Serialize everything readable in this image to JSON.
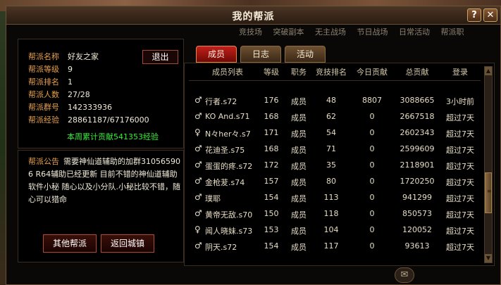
{
  "window": {
    "title": "我的帮派",
    "help_label": "?",
    "close_label": "✕"
  },
  "subnav": [
    "竞技场",
    "突破副本",
    "无主战场",
    "节日战场",
    "日常活动",
    "帮派职"
  ],
  "guild": {
    "name_label": "帮派名称",
    "name": "好友之家",
    "level_label": "帮派等级",
    "level": "9",
    "rank_label": "帮派排名",
    "rank": "1",
    "members_label": "帮派人数",
    "members": "27/28",
    "group_label": "帮派群号",
    "group": "142333936",
    "exp_label": "帮派经验",
    "exp": "28861187/67176000",
    "weekly_contrib": "本周累计贡献541353经验",
    "exit_label": "退出"
  },
  "notice": {
    "label": "帮派公告",
    "text": "需要神仙道辅助的加群310565906 R64辅助已经更新 目前不错的神仙道辅助软件小秘 随心以及小分队.小秘比较不错，随心可以猎命"
  },
  "buttons": {
    "other_guilds": "其他帮派",
    "return_city": "返回城镇"
  },
  "tabs": [
    "成员",
    "日志",
    "活动"
  ],
  "list": {
    "headers": [
      "成员列表",
      "等级",
      "职务",
      "竞技排名",
      "今日贡献",
      "总贡献",
      "登录"
    ],
    "rows": [
      {
        "gender": "♂",
        "name": "行者.s72",
        "level": "176",
        "role": "成员",
        "rank": "48",
        "today": "8807",
        "total": "3088665",
        "login": "3小时前"
      },
      {
        "gender": "♂",
        "name": "KO And.s71",
        "level": "168",
        "role": "成员",
        "rank": "62",
        "today": "0",
        "total": "2667518",
        "login": "超过7天"
      },
      {
        "gender": "♀",
        "name": "N々her々.s7",
        "level": "171",
        "role": "成员",
        "rank": "54",
        "today": "0",
        "total": "2602343",
        "login": "超过7天"
      },
      {
        "gender": "♂",
        "name": "花迪圣.s75",
        "level": "168",
        "role": "成员",
        "rank": "71",
        "today": "0",
        "total": "2599609",
        "login": "超过7天"
      },
      {
        "gender": "♂",
        "name": "蛋蛋的疼.s72",
        "level": "172",
        "role": "成员",
        "rank": "35",
        "today": "0",
        "total": "2118901",
        "login": "超过7天"
      },
      {
        "gender": "♂",
        "name": "金枪茇.s74",
        "level": "157",
        "role": "成员",
        "rank": "80",
        "today": "0",
        "total": "1720250",
        "login": "超过7天"
      },
      {
        "gender": "♂",
        "name": "璞耶",
        "level": "154",
        "role": "成员",
        "rank": "113",
        "today": "0",
        "total": "941299",
        "login": "超过7天"
      },
      {
        "gender": "♂",
        "name": "黄帝无敌.s70",
        "level": "150",
        "role": "成员",
        "rank": "118",
        "today": "0",
        "total": "850573",
        "login": "超过7天"
      },
      {
        "gender": "♀",
        "name": "闻人晓妹.s73",
        "level": "153",
        "role": "成员",
        "rank": "104",
        "today": "0",
        "total": "120052",
        "login": "超过7天"
      },
      {
        "gender": "♂",
        "name": "阴天.s72",
        "level": "154",
        "role": "成员",
        "rank": "117",
        "today": "0",
        "total": "93613",
        "login": "超过7天"
      }
    ]
  },
  "scroll": {
    "up": "▲",
    "down": "▼",
    "grip": "≡"
  },
  "mail_icon": "✉"
}
